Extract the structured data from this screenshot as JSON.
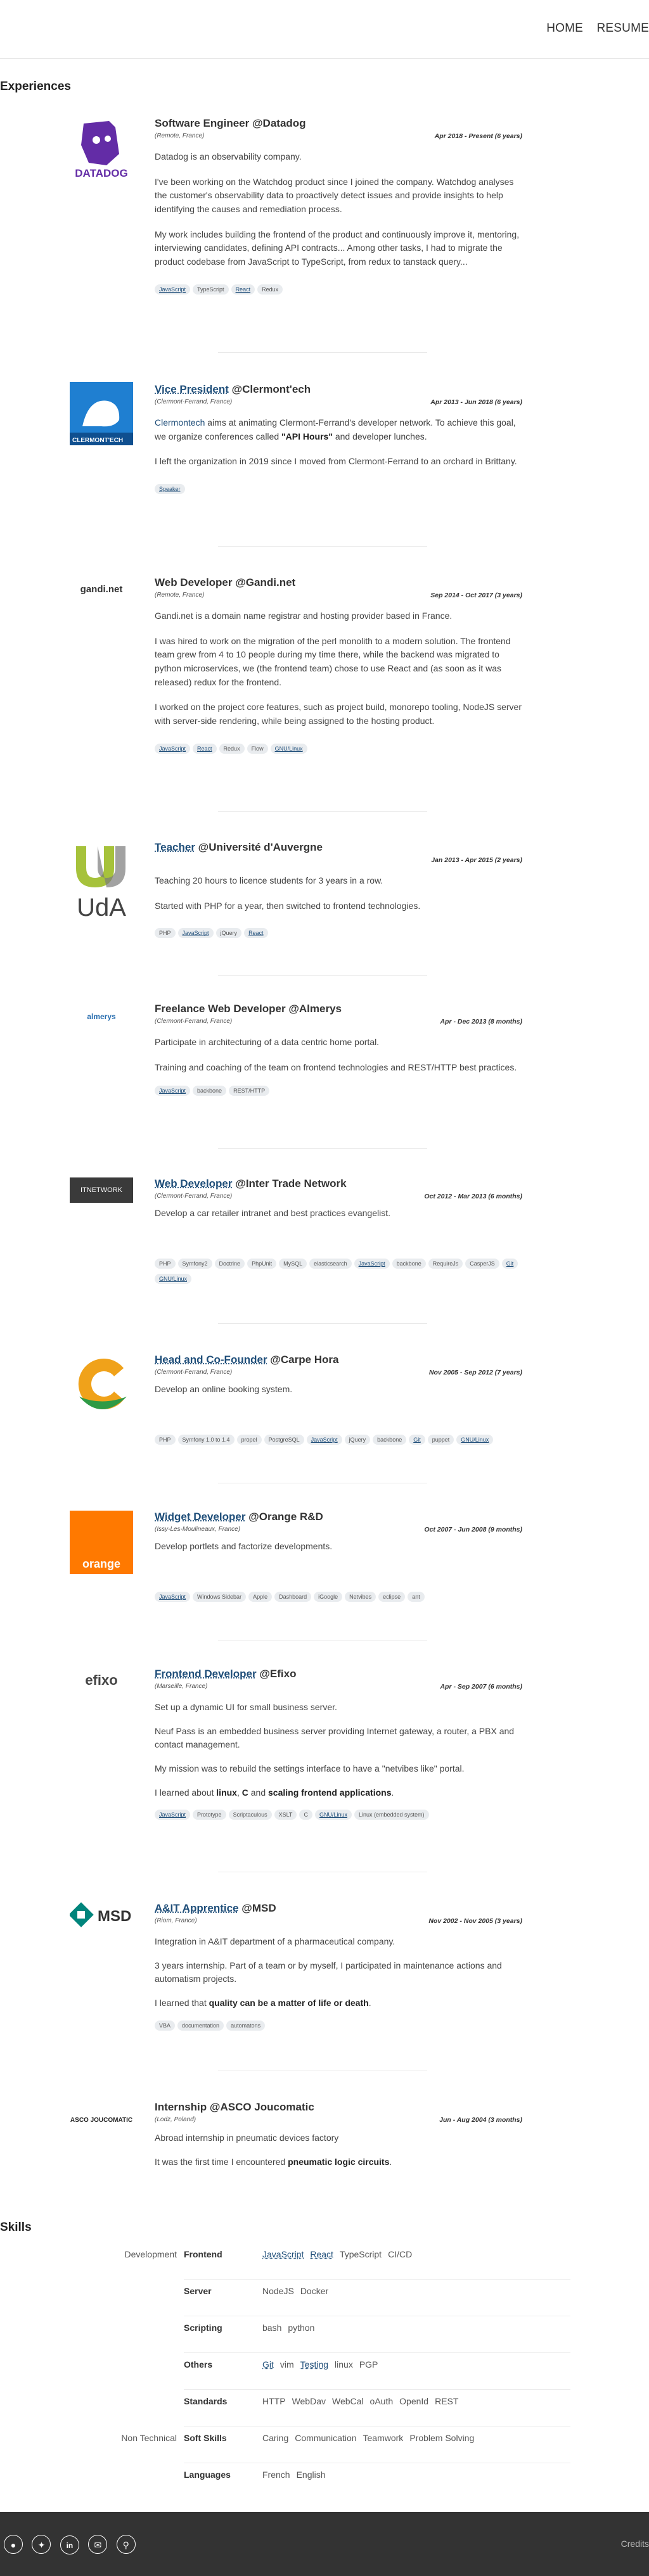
{
  "nav": {
    "home": "HOME",
    "resume": "RESUME"
  },
  "experiences_title": "Experiences",
  "jobs": [
    {
      "title": "Software Engineer @Datadog",
      "location": "(Remote, France)",
      "period": "Apr 2018 - Present (6 years)",
      "paragraphs": [
        "Datadog is an observability company.",
        "I've been working on the Watchdog product since I joined the company. Watchdog analyses the customer's observability data to proactively detect issues and provide insights to help identifying the causes and remediation process.",
        "My work includes building the frontend of the product and continuously improve it, mentoring, interviewing candidates, defining API contracts... Among other tasks, I had to migrate the product codebase from JavaScript to TypeScript, from redux to tanstack query..."
      ],
      "tags": [
        "JavaScript",
        "TypeScript",
        "React",
        "Redux"
      ],
      "logo_text": "DATADOG"
    },
    {
      "title_link": "Vice President",
      "title_rest": " @Clermont'ech",
      "location": "(Clermont-Ferrand, France)",
      "period": "Apr 2013 - Jun 2018 (6 years)",
      "p1_link": "Clermontech",
      "p1_rest": " aims at animating Clermont-Ferrand's developer network. To achieve this goal, we organize conferences called ",
      "p1_bold": "\"API Hours\"",
      "p1_end": " and developer lunches.",
      "p2": "I left the organization in 2019 since I moved from Clermont-Ferrand to an orchard in Brittany.",
      "tags": [
        "Speaker"
      ],
      "logo_text": "CLERMONT'ECH"
    },
    {
      "title": "Web Developer @Gandi.net",
      "location": "(Remote, France)",
      "period": "Sep 2014 - Oct 2017 (3 years)",
      "paragraphs": [
        "Gandi.net is a domain name registrar and hosting provider based in France.",
        "I was hired to work on the migration of the perl monolith to a modern solution. The frontend team grew from 4 to 10 people during my time there, while the backend was migrated to python microservices, we (the frontend team) chose to use React and (as soon as it was released) redux for the frontend.",
        "I worked on the project core features, such as project build, monorepo tooling, NodeJS server with server-side rendering, while being assigned to the hosting product."
      ],
      "tags": [
        "JavaScript",
        "React",
        "Redux",
        "Flow",
        "GNU/Linux"
      ],
      "logo_text": "gandi.net"
    },
    {
      "title_link": "Teacher",
      "title_rest": " @Université d'Auvergne",
      "location": "",
      "period": "Jan 2013 - Apr 2015 (2 years)",
      "paragraphs": [
        "Teaching 20 hours to licence students for 3 years in a row.",
        "Started with PHP for a year, then switched to frontend technologies."
      ],
      "tags": [
        "PHP",
        "JavaScript",
        "jQuery",
        "React"
      ],
      "logo_text": "UdA"
    },
    {
      "title": "Freelance Web Developer @Almerys",
      "location": "(Clermont-Ferrand, France)",
      "period": "Apr - Dec 2013 (8 months)",
      "paragraphs": [
        "Participate in architecturing of a data centric home portal.",
        "Training and coaching of the team on frontend technologies and REST/HTTP best practices."
      ],
      "tags": [
        "JavaScript",
        "backbone",
        "REST/HTTP"
      ],
      "logo_text": "almerys"
    },
    {
      "title_link": "Web Developer",
      "title_rest": " @Inter Trade Network",
      "location": "(Clermont-Ferrand, France)",
      "period": "Oct 2012 - Mar 2013 (6 months)",
      "paragraphs": [
        "Develop a car retailer intranet and best practices evangelist."
      ],
      "tags": [
        "PHP",
        "Symfony2",
        "Doctrine",
        "PhpUnit",
        "MySQL",
        "elasticsearch",
        "JavaScript",
        "backbone",
        "RequireJs",
        "CasperJS",
        "Git",
        "GNU/Linux"
      ],
      "logo_text": "ITNETWORK"
    },
    {
      "title_link": "Head and Co-Founder",
      "title_rest": " @Carpe Hora",
      "location": "(Clermont-Ferrand, France)",
      "period": "Nov 2005 - Sep 2012 (7 years)",
      "paragraphs": [
        "Develop an online booking system."
      ],
      "tags": [
        "PHP",
        "Symfony 1.0 to 1.4",
        "propel",
        "PostgreSQL",
        "JavaScript",
        "jQuery",
        "backbone",
        "Git",
        "puppet",
        "GNU/Linux"
      ],
      "logo_text": ""
    },
    {
      "title_link": "Widget Developer",
      "title_rest": " @Orange R&D",
      "location": "(Issy-Les-Moulineaux, France)",
      "period": "Oct 2007 - Jun 2008 (9 months)",
      "paragraphs": [
        "Develop portlets and factorize developments."
      ],
      "tags": [
        "JavaScript",
        "Windows Sidebar",
        "Apple",
        "Dashboard",
        "iGoogle",
        "Netvibes",
        "eclipse",
        "ant"
      ],
      "logo_text": "orange"
    },
    {
      "title_link": "Frontend Developer",
      "title_rest": " @Efixo",
      "location": "(Marseille, France)",
      "period": "Apr - Sep 2007 (6 months)",
      "paragraphs": [
        "Set up a dynamic UI for small business server.",
        "Neuf Pass is an embedded business server providing Internet gateway, a router, a PBX and contact management.",
        "My mission was to rebuild the settings interface to have a \"netvibes like\" portal."
      ],
      "p_last_pre": "I learned about ",
      "p_last_b1": "linux",
      "p_last_m1": ", ",
      "p_last_b2": "C",
      "p_last_m2": " and ",
      "p_last_b3": "scaling frontend applications",
      "p_last_end": ".",
      "tags": [
        "JavaScript",
        "Prototype",
        "Scriptaculous",
        "XSLT",
        "C",
        "GNU/Linux",
        "Linux (embedded system)"
      ],
      "logo_text": "efixo"
    },
    {
      "title_link": "A&IT Apprentice",
      "title_rest": " @MSD",
      "location": "(Riom, France)",
      "period": "Nov 2002 - Nov 2005 (3 years)",
      "paragraphs": [
        "Integration in A&IT department of a pharmaceutical company.",
        "3 years internship. Part of a team or by myself, I participated in maintenance actions and automatism projects."
      ],
      "p_last_pre": "I learned that ",
      "p_last_b1": "quality can be a matter of life or death",
      "p_last_end": ".",
      "tags": [
        "VBA",
        "documentation",
        "automatons"
      ],
      "logo_text": "MSD"
    },
    {
      "title": "Internship @ASCO Joucomatic",
      "location": "(Lodz, Poland)",
      "period": "Jun - Aug 2004 (3 months)",
      "paragraphs": [
        "Abroad internship in pneumatic devices factory"
      ],
      "p_last_pre": "It was the first time I encountered ",
      "p_last_b1": "pneumatic logic circuits",
      "p_last_end": ".",
      "tags": [],
      "logo_text": "ASCO JOUCOMATIC"
    }
  ],
  "skills_title": "Skills",
  "skills": [
    {
      "category": "Development",
      "name": "Frontend",
      "items": [
        "JavaScript",
        "React",
        "TypeScript",
        "CI/CD"
      ]
    },
    {
      "category": "",
      "name": "Server",
      "items": [
        "NodeJS",
        "Docker"
      ]
    },
    {
      "category": "",
      "name": "Scripting",
      "items": [
        "bash",
        "python"
      ]
    },
    {
      "category": "",
      "name": "Others",
      "items": [
        "Git",
        "vim",
        "Testing",
        "linux",
        "PGP"
      ]
    },
    {
      "category": "",
      "name": "Standards",
      "items": [
        "HTTP",
        "WebDav",
        "WebCal",
        "oAuth",
        "OpenId",
        "REST"
      ]
    },
    {
      "category": "Non Technical",
      "name": "Soft Skills",
      "items": [
        "Caring",
        "Communication",
        "Teamwork",
        "Problem Solving"
      ]
    },
    {
      "category": "",
      "name": "Languages",
      "items": [
        "French",
        "English"
      ]
    }
  ],
  "footer": {
    "credits": "Credits"
  }
}
